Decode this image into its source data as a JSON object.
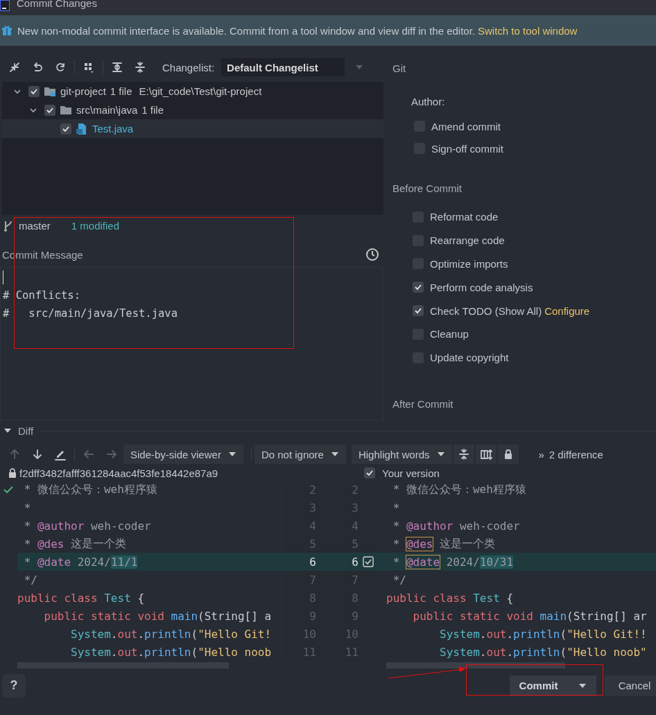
{
  "window": {
    "title": "Commit Changes"
  },
  "banner": {
    "text": "New non-modal commit interface is available. Commit from a tool window and view diff in the editor.",
    "link": "Switch to tool window"
  },
  "toolbar": {
    "tools": [
      {
        "kind": "move"
      },
      {
        "kind": "undo"
      },
      {
        "kind": "refresh"
      },
      {
        "kind": "group"
      },
      {
        "kind": "expand"
      },
      {
        "kind": "collapse"
      }
    ],
    "changelist_label": "Changelist:",
    "changelist": "Default Changelist"
  },
  "tree": [
    {
      "label": "git-project",
      "count": "1 file",
      "path": "E:\\git_code\\Test\\git-project",
      "kind": "module",
      "checked": true,
      "expanded": true,
      "selected": false,
      "children": [
        {
          "label": "src\\main\\java",
          "count": "1 file",
          "kind": "folder",
          "checked": true,
          "expanded": true,
          "selected": false,
          "children": [
            {
              "label": "Test.java",
              "kind": "file",
              "checked": true,
              "selected": true
            }
          ]
        }
      ]
    }
  ],
  "branch": {
    "name": "master",
    "status": "1 modified"
  },
  "commit_message": {
    "label": "Commit Message",
    "value": "\n# Conflicts:\n#   src/main/java/Test.java"
  },
  "git_panel": {
    "title": "Git",
    "author_label": "Author:",
    "options": [
      {
        "label": "Amend commit",
        "checked": false
      },
      {
        "label": "Sign-off commit",
        "checked": false
      }
    ]
  },
  "before_commit": {
    "title": "Before Commit",
    "options": [
      {
        "label": "Reformat code",
        "checked": false
      },
      {
        "label": "Rearrange code",
        "checked": false
      },
      {
        "label": "Optimize imports",
        "checked": false
      },
      {
        "label": "Perform code analysis",
        "checked": true
      },
      {
        "label": "Check TODO (Show All)",
        "checked": true,
        "link": "Configure"
      },
      {
        "label": "Cleanup",
        "checked": false
      },
      {
        "label": "Update copyright",
        "checked": false
      }
    ]
  },
  "after_commit": {
    "title": "After Commit"
  },
  "diff": {
    "title": "Diff",
    "expanded": true,
    "nav": [
      {
        "kind": "up",
        "disabled": true
      },
      {
        "kind": "down",
        "disabled": false
      },
      {
        "kind": "edit",
        "disabled": false
      },
      {
        "kind": "back",
        "disabled": true
      },
      {
        "kind": "forward",
        "disabled": true
      }
    ],
    "dropdowns": [
      "Side-by-side viewer",
      "Do not ignore",
      "Highlight words"
    ],
    "tools": [
      {
        "kind": "collapse"
      },
      {
        "kind": "split"
      },
      {
        "kind": "lock"
      }
    ],
    "more": "»",
    "count": "2 difference",
    "left_title": "f2dff3482fafff361284aac4f53fe18442e87a9",
    "right_title": "Your version",
    "right_checked": true,
    "lines": [
      {
        "left_number": "2",
        "right_number": "2",
        "changed": false,
        "left": [
          {
            "text": " * 微信公众号：weh程序猿",
            "kind": "comment"
          }
        ],
        "right": [
          {
            "text": " * 微信公众号：weh程序猿",
            "kind": "comment"
          }
        ]
      },
      {
        "left_number": "3",
        "right_number": "3",
        "changed": false,
        "left": [
          {
            "text": " *",
            "kind": "comment"
          }
        ],
        "right": [
          {
            "text": " *",
            "kind": "comment"
          }
        ]
      },
      {
        "left_number": "4",
        "right_number": "4",
        "changed": false,
        "left": [
          {
            "text": " * ",
            "kind": "comment"
          },
          {
            "text": "@author",
            "kind": "tag"
          },
          {
            "text": " weh-coder",
            "kind": "comment"
          }
        ],
        "right": [
          {
            "text": " * ",
            "kind": "comment"
          },
          {
            "text": "@author",
            "kind": "tag"
          },
          {
            "text": " weh-coder",
            "kind": "comment"
          }
        ]
      },
      {
        "left_number": "5",
        "right_number": "5",
        "changed": false,
        "left": [
          {
            "text": " * ",
            "kind": "comment"
          },
          {
            "text": "@des",
            "kind": "tag"
          },
          {
            "text": " 这是一个类",
            "kind": "comment"
          }
        ],
        "right": [
          {
            "text": " * ",
            "kind": "comment"
          },
          {
            "text": "@des",
            "kind": "conflict"
          },
          {
            "text": " 这是一个类",
            "kind": "comment"
          }
        ]
      },
      {
        "left_number": "6",
        "right_number": "6",
        "changed": true,
        "left": [
          {
            "text": " * ",
            "kind": "comment"
          },
          {
            "text": "@date",
            "kind": "tag"
          },
          {
            "text": " 2024/",
            "kind": "comment"
          },
          {
            "text": "11/1",
            "kind": "changed"
          }
        ],
        "right": [
          {
            "text": " * ",
            "kind": "comment"
          },
          {
            "text": "@date",
            "kind": "conflict"
          },
          {
            "text": " 2024/",
            "kind": "comment"
          },
          {
            "text": "10/31",
            "kind": "changed"
          }
        ]
      },
      {
        "left_number": "7",
        "right_number": "7",
        "changed": false,
        "left": [
          {
            "text": " */",
            "kind": "comment"
          }
        ],
        "right": [
          {
            "text": " */",
            "kind": "comment"
          }
        ]
      },
      {
        "left_number": "8",
        "right_number": "8",
        "changed": false,
        "left": [
          {
            "text": "public class ",
            "kind": "keyword"
          },
          {
            "text": "Test",
            "kind": "type"
          },
          {
            "text": " {",
            "kind": "plain"
          }
        ],
        "right": [
          {
            "text": "public class ",
            "kind": "keyword"
          },
          {
            "text": "Test",
            "kind": "type"
          },
          {
            "text": " {",
            "kind": "plain"
          }
        ]
      },
      {
        "left_number": "9",
        "right_number": "9",
        "changed": false,
        "left": [
          {
            "text": "    public static void ",
            "kind": "keyword"
          },
          {
            "text": "main",
            "kind": "method"
          },
          {
            "text": "(String[] a",
            "kind": "plain"
          }
        ],
        "right": [
          {
            "text": "    public static void ",
            "kind": "keyword"
          },
          {
            "text": "main",
            "kind": "method"
          },
          {
            "text": "(String[] ar",
            "kind": "plain"
          }
        ]
      },
      {
        "left_number": "10",
        "right_number": "10",
        "changed": false,
        "left": [
          {
            "text": "        System",
            "kind": "type"
          },
          {
            "text": ".",
            "kind": "plain"
          },
          {
            "text": "out",
            "kind": "field"
          },
          {
            "text": ".",
            "kind": "plain"
          },
          {
            "text": "println",
            "kind": "method"
          },
          {
            "text": "(",
            "kind": "plain"
          },
          {
            "text": "\"Hello Git!",
            "kind": "string"
          }
        ],
        "right": [
          {
            "text": "        System",
            "kind": "type"
          },
          {
            "text": ".",
            "kind": "plain"
          },
          {
            "text": "out",
            "kind": "field"
          },
          {
            "text": ".",
            "kind": "plain"
          },
          {
            "text": "println",
            "kind": "method"
          },
          {
            "text": "(",
            "kind": "plain"
          },
          {
            "text": "\"Hello Git!!",
            "kind": "string"
          }
        ]
      },
      {
        "left_number": "11",
        "right_number": "11",
        "changed": false,
        "left": [
          {
            "text": "        System",
            "kind": "type"
          },
          {
            "text": ".",
            "kind": "plain"
          },
          {
            "text": "out",
            "kind": "field"
          },
          {
            "text": ".",
            "kind": "plain"
          },
          {
            "text": "println",
            "kind": "method"
          },
          {
            "text": "(",
            "kind": "plain"
          },
          {
            "text": "\"Hello noob",
            "kind": "string"
          }
        ],
        "right": [
          {
            "text": "        System",
            "kind": "type"
          },
          {
            "text": ".",
            "kind": "plain"
          },
          {
            "text": "out",
            "kind": "field"
          },
          {
            "text": ".",
            "kind": "plain"
          },
          {
            "text": "println",
            "kind": "method"
          },
          {
            "text": "(",
            "kind": "plain"
          },
          {
            "text": "\"Hello noob\"",
            "kind": "string"
          }
        ]
      }
    ]
  },
  "help": "?",
  "buttons": [
    {
      "label": "Commit",
      "kind": "primary"
    },
    {
      "label": "Cancel",
      "kind": "secondary"
    }
  ]
}
